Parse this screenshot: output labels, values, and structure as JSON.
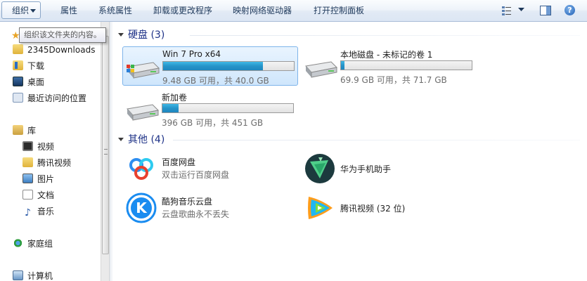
{
  "toolbar": {
    "organize": "组织",
    "properties": "属性",
    "system_properties": "系统属性",
    "uninstall": "卸载或更改程序",
    "map_drive": "映射网络驱动器",
    "control_panel": "打开控制面板"
  },
  "tooltip": "组织该文件夹的内容。",
  "nav": {
    "favorites": [
      {
        "label": "2345Downloads",
        "icon": "folder-icon"
      },
      {
        "label": "下载",
        "icon": "downloads-icon"
      },
      {
        "label": "桌面",
        "icon": "desktop-icon"
      },
      {
        "label": "最近访问的位置",
        "icon": "recent-places-icon"
      }
    ],
    "libraries_label": "库",
    "libraries": [
      {
        "label": "视频",
        "icon": "video-icon"
      },
      {
        "label": "腾讯视频",
        "icon": "folder-icon"
      },
      {
        "label": "图片",
        "icon": "pictures-icon"
      },
      {
        "label": "文档",
        "icon": "documents-icon"
      },
      {
        "label": "音乐",
        "icon": "music-icon"
      }
    ],
    "homegroup": "家庭组",
    "computer": "计算机"
  },
  "groups": {
    "hard_disks": "硬盘 (3)",
    "other": "其他 (4)"
  },
  "drives": [
    {
      "name": "Win 7 Pro x64",
      "free": "9.48 GB 可用，共 40.0 GB",
      "used_fraction": 0.763
    },
    {
      "name": "本地磁盘 - 未标记的卷 1",
      "free": "69.9 GB 可用，共 71.7 GB",
      "used_fraction": 0.025
    },
    {
      "name": "新加卷",
      "free": "396 GB 可用，共 451 GB",
      "used_fraction": 0.122
    }
  ],
  "apps": [
    {
      "name": "百度网盘",
      "desc": "双击运行百度网盘",
      "icon": "baidu-netdisk-icon"
    },
    {
      "name": "华为手机助手",
      "desc": "",
      "icon": "huawei-assistant-icon"
    },
    {
      "name": "酷狗音乐云盘",
      "desc": "云盘歌曲永不丢失",
      "icon": "kugou-icon"
    },
    {
      "name": "腾讯视频 (32 位)",
      "desc": "",
      "icon": "tencent-video-icon"
    }
  ],
  "colors": {
    "accent": "#1e3287",
    "progress": "#2694c9",
    "selection": "#cfe6fc"
  }
}
